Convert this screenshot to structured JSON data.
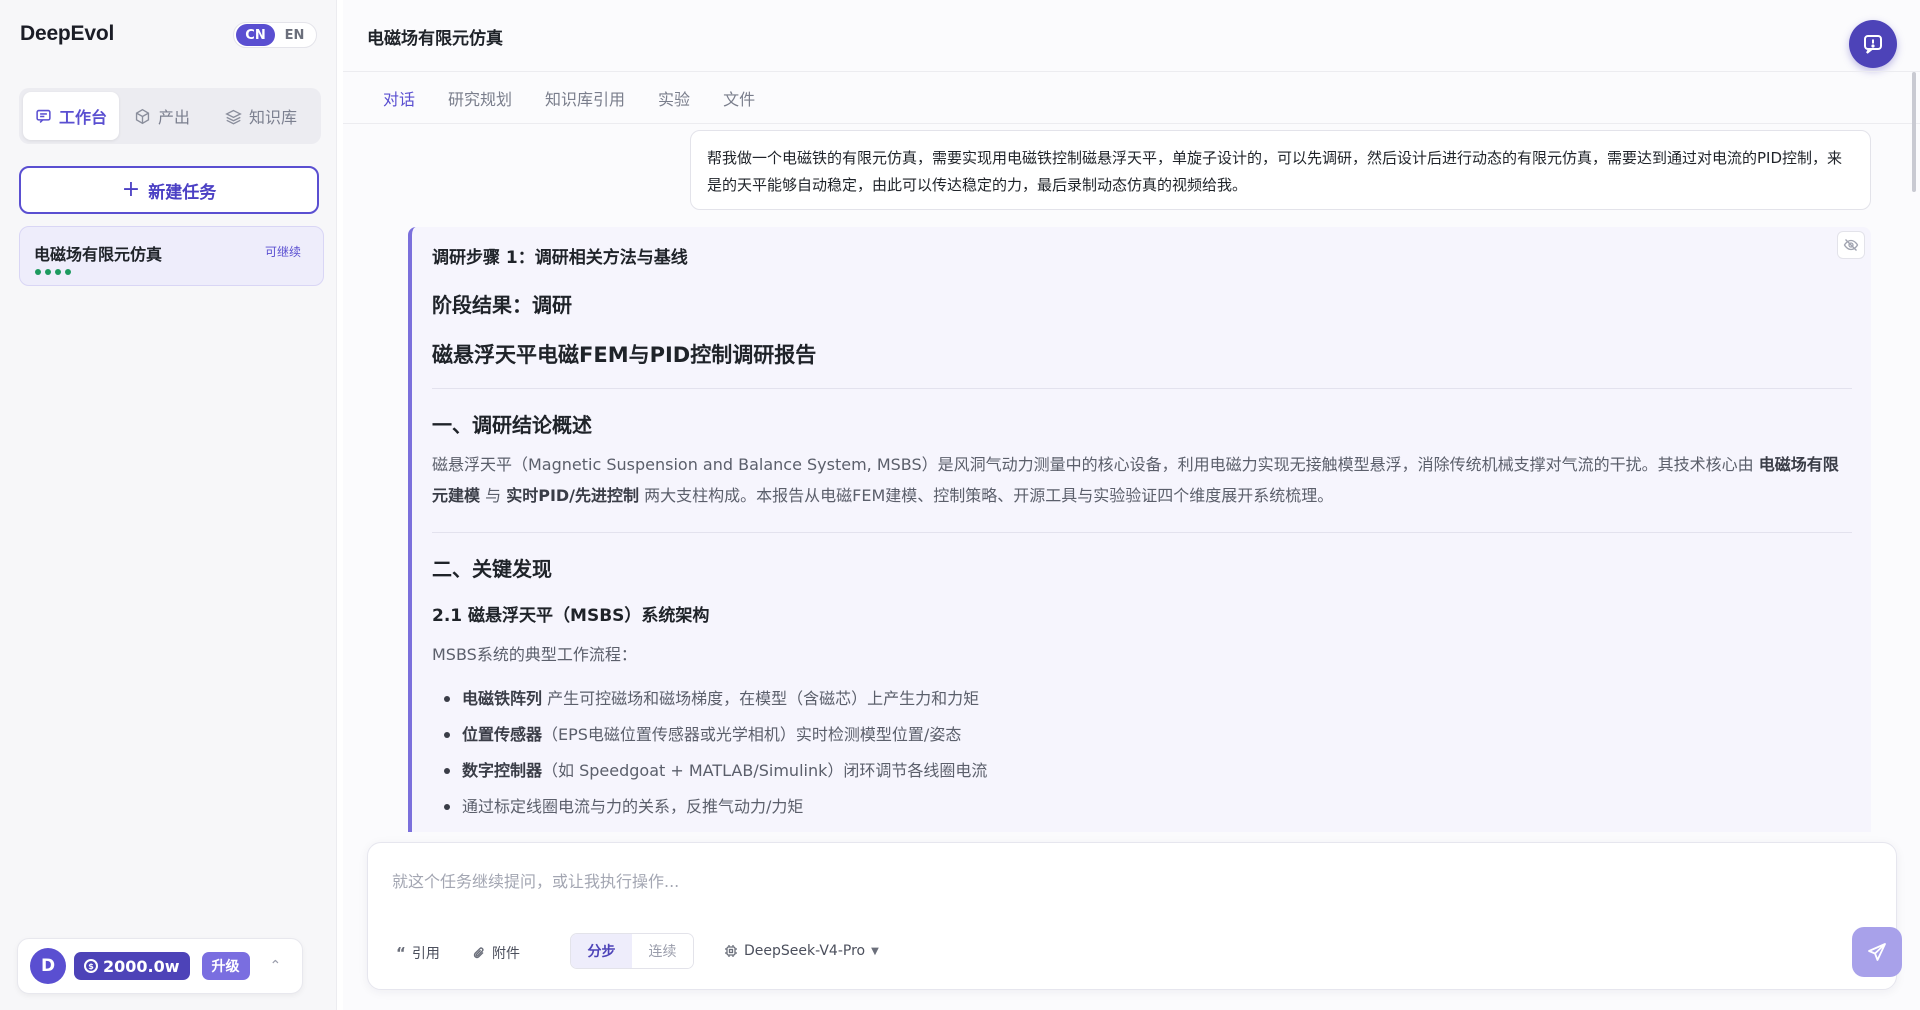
{
  "app": {
    "brand": "DeepEvol"
  },
  "lang": {
    "cn": "CN",
    "en": "EN"
  },
  "sidebar": {
    "nav": [
      {
        "label": "工作台",
        "icon": "chat-icon"
      },
      {
        "label": "产出",
        "icon": "box-icon"
      },
      {
        "label": "知识库",
        "icon": "layers-icon"
      }
    ],
    "new_task": "新建任务",
    "tasks": [
      {
        "title": "电磁场有限元仿真",
        "status": "可继续"
      }
    ],
    "account": {
      "avatar": "D",
      "credits": "2000.0w",
      "upgrade": "升级"
    }
  },
  "main": {
    "title": "电磁场有限元仿真",
    "tabs": [
      "对话",
      "研究规划",
      "知识库引用",
      "实验",
      "文件"
    ],
    "user_message": "帮我做一个电磁铁的有限元仿真，需要实现用电磁铁控制磁悬浮天平，单旋子设计的，可以先调研，然后设计后进行动态的有限元仿真，需要达到通过对电流的PID控制，来是的天平能够自动稳定，由此可以传达稳定的力，最后录制动态仿真的视频给我。",
    "result": {
      "step": "调研步骤 1：调研相关方法与基线",
      "stage": "阶段结果：调研",
      "report_title": "磁悬浮天平电磁FEM与PID控制调研报告",
      "sec1_title": "一、调研结论概述",
      "sec1_p1": "磁悬浮天平（Magnetic Suspension and Balance System, MSBS）是风洞气动力测量中的核心设备，利用电磁力实现无接触模型悬浮，消除传统机械支撑对气流的干扰。其技术核心由",
      "sec1_b1": "电磁场有限元建模",
      "sec1_mid": "与",
      "sec1_b2": "实时PID/先进控制",
      "sec1_p2": "两大支柱构成。本报告从电磁FEM建模、控制策略、开源工具与实验验证四个维度展开系统梳理。",
      "sec2_title": "二、关键发现",
      "sec21_title": "2.1 磁悬浮天平（MSBS）系统架构",
      "sec21_intro": "MSBS系统的典型工作流程：",
      "bullets": [
        {
          "bold": "电磁铁阵列",
          "text": "产生可控磁场和磁场梯度，在模型（含磁芯）上产生力和力矩"
        },
        {
          "bold": "位置传感器",
          "text": "（EPS电磁位置传感器或光学相机）实时检测模型位置/姿态"
        },
        {
          "bold": "数字控制器",
          "text": "（如 Speedgoat + MATLAB/Simulink）闭环调节各线圈电流"
        },
        {
          "bold": "",
          "text": "通过标定线圈电流与力的关系，反推气动力/力矩"
        }
      ]
    },
    "composer": {
      "placeholder": "就这个任务继续提问，或让我执行操作...",
      "cite": "引用",
      "attach": "附件",
      "mode_step": "分步",
      "mode_continuous": "连续",
      "model": "DeepSeek-V4-Pro"
    }
  },
  "colors": {
    "accent": "#5a4fd1",
    "accent_dark": "#4d43b8",
    "status_green": "#1d9a5f"
  }
}
